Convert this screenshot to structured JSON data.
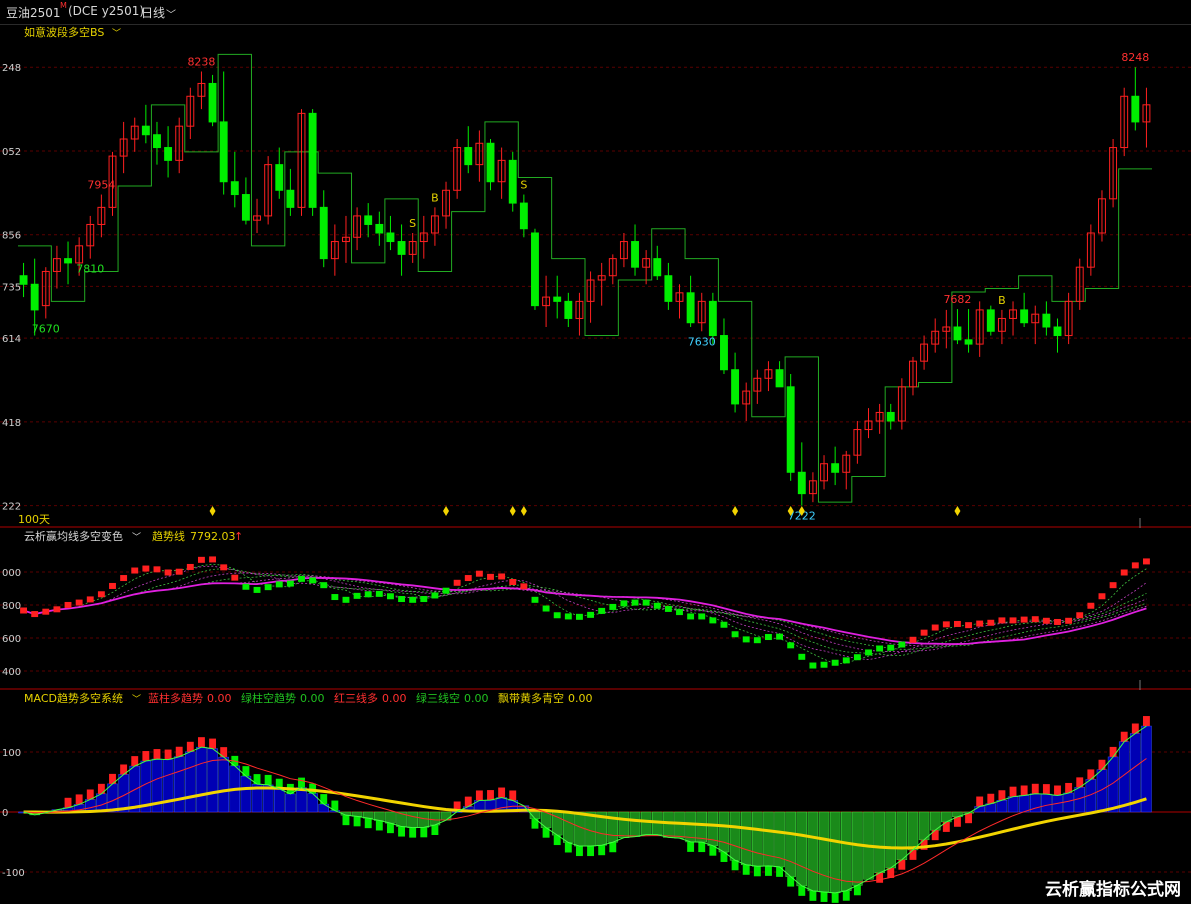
{
  "topbar": {
    "symbol": "豆油2501",
    "symbol_sup": "M",
    "exchange": "(DCE  y2501)",
    "period": "日线"
  },
  "colors": {
    "up": "#ff2020",
    "down": "#00ee00",
    "grid": "#5a0000",
    "axis": "#a00000",
    "macd_blue": "#0000b4",
    "yellow": "#f2d400",
    "cyan": "#7fe6ff",
    "magenta": "#e020e0"
  },
  "chart_data": [
    {
      "type": "candlestick",
      "title": "如意波段多空BS",
      "y_ticks": [
        "248",
        "052",
        "856",
        "735",
        "614",
        "418",
        "222"
      ],
      "y_tick_values": [
        8248,
        8052,
        7856,
        7735,
        7614,
        7418,
        7222
      ],
      "ylim": [
        7200,
        8300
      ],
      "range_label": "100天",
      "annotations": [
        {
          "text": "8238",
          "kind": "high"
        },
        {
          "text": "7630",
          "kind": "low"
        },
        {
          "text": "7954",
          "kind": "high"
        },
        {
          "text": "7810",
          "kind": "low"
        },
        {
          "text": "7670",
          "kind": "low"
        },
        {
          "text": "7222",
          "kind": "low"
        },
        {
          "text": "7682",
          "kind": "high"
        },
        {
          "text": "8248",
          "kind": "high"
        }
      ],
      "signals": [
        {
          "text": "S",
          "bar": 35
        },
        {
          "text": "B",
          "bar": 37
        },
        {
          "text": "S",
          "bar": 45
        },
        {
          "text": "B",
          "bar": 88
        }
      ],
      "diamond_bars": [
        17,
        38,
        44,
        45,
        64,
        69,
        70,
        84
      ],
      "ohlc": [
        [
          7760,
          7790,
          7710,
          7740
        ],
        [
          7740,
          7800,
          7620,
          7680
        ],
        [
          7690,
          7780,
          7660,
          7770
        ],
        [
          7770,
          7830,
          7730,
          7800
        ],
        [
          7800,
          7840,
          7740,
          7790
        ],
        [
          7790,
          7850,
          7760,
          7830
        ],
        [
          7830,
          7900,
          7800,
          7880
        ],
        [
          7880,
          7950,
          7850,
          7920
        ],
        [
          7920,
          8050,
          7900,
          8040
        ],
        [
          8040,
          8120,
          8000,
          8080
        ],
        [
          8080,
          8130,
          8050,
          8110
        ],
        [
          8110,
          8160,
          8070,
          8090
        ],
        [
          8090,
          8120,
          8020,
          8060
        ],
        [
          8060,
          8110,
          7990,
          8030
        ],
        [
          8030,
          8130,
          8000,
          8110
        ],
        [
          8110,
          8200,
          8080,
          8180
        ],
        [
          8180,
          8238,
          8150,
          8210
        ],
        [
          8210,
          8230,
          8110,
          8120
        ],
        [
          8120,
          8238,
          7950,
          7980
        ],
        [
          7980,
          8050,
          7920,
          7950
        ],
        [
          7950,
          7990,
          7880,
          7890
        ],
        [
          7890,
          7940,
          7860,
          7900
        ],
        [
          7900,
          8040,
          7880,
          8020
        ],
        [
          8020,
          8060,
          7940,
          7960
        ],
        [
          7960,
          8010,
          7900,
          7920
        ],
        [
          7920,
          8150,
          7900,
          8140
        ],
        [
          8140,
          8150,
          7900,
          7920
        ],
        [
          7920,
          7960,
          7780,
          7800
        ],
        [
          7800,
          7880,
          7760,
          7840
        ],
        [
          7840,
          7900,
          7790,
          7850
        ],
        [
          7850,
          7920,
          7820,
          7900
        ],
        [
          7900,
          7930,
          7850,
          7880
        ],
        [
          7880,
          7910,
          7830,
          7860
        ],
        [
          7860,
          7900,
          7820,
          7840
        ],
        [
          7840,
          7880,
          7760,
          7810
        ],
        [
          7810,
          7860,
          7790,
          7840
        ],
        [
          7840,
          7900,
          7800,
          7860
        ],
        [
          7860,
          7920,
          7830,
          7900
        ],
        [
          7900,
          7980,
          7870,
          7960
        ],
        [
          7960,
          8080,
          7940,
          8060
        ],
        [
          8060,
          8110,
          8000,
          8020
        ],
        [
          8020,
          8100,
          7980,
          8070
        ],
        [
          8070,
          8080,
          7960,
          7980
        ],
        [
          7980,
          8060,
          7940,
          8030
        ],
        [
          8030,
          8050,
          7910,
          7930
        ],
        [
          7930,
          7950,
          7850,
          7870
        ],
        [
          7860,
          7870,
          7680,
          7690
        ],
        [
          7690,
          7760,
          7640,
          7710
        ],
        [
          7710,
          7760,
          7660,
          7700
        ],
        [
          7700,
          7720,
          7640,
          7660
        ],
        [
          7660,
          7720,
          7620,
          7700
        ],
        [
          7700,
          7770,
          7650,
          7750
        ],
        [
          7750,
          7790,
          7690,
          7760
        ],
        [
          7760,
          7810,
          7740,
          7800
        ],
        [
          7800,
          7860,
          7780,
          7840
        ],
        [
          7840,
          7880,
          7760,
          7780
        ],
        [
          7780,
          7820,
          7740,
          7800
        ],
        [
          7800,
          7830,
          7750,
          7760
        ],
        [
          7760,
          7790,
          7680,
          7700
        ],
        [
          7700,
          7740,
          7660,
          7720
        ],
        [
          7720,
          7760,
          7640,
          7650
        ],
        [
          7650,
          7720,
          7630,
          7700
        ],
        [
          7700,
          7720,
          7600,
          7620
        ],
        [
          7620,
          7660,
          7530,
          7540
        ],
        [
          7540,
          7580,
          7440,
          7460
        ],
        [
          7460,
          7510,
          7420,
          7490
        ],
        [
          7490,
          7540,
          7460,
          7520
        ],
        [
          7520,
          7560,
          7490,
          7540
        ],
        [
          7540,
          7560,
          7500,
          7500
        ],
        [
          7500,
          7530,
          7280,
          7300
        ],
        [
          7300,
          7370,
          7222,
          7250
        ],
        [
          7250,
          7300,
          7230,
          7280
        ],
        [
          7280,
          7340,
          7260,
          7320
        ],
        [
          7320,
          7360,
          7270,
          7300
        ],
        [
          7300,
          7350,
          7260,
          7340
        ],
        [
          7340,
          7420,
          7320,
          7400
        ],
        [
          7400,
          7450,
          7380,
          7420
        ],
        [
          7420,
          7460,
          7390,
          7440
        ],
        [
          7440,
          7460,
          7400,
          7420
        ],
        [
          7420,
          7520,
          7400,
          7500
        ],
        [
          7500,
          7570,
          7480,
          7560
        ],
        [
          7560,
          7620,
          7540,
          7600
        ],
        [
          7600,
          7660,
          7580,
          7630
        ],
        [
          7630,
          7680,
          7590,
          7640
        ],
        [
          7640,
          7682,
          7600,
          7610
        ],
        [
          7610,
          7682,
          7580,
          7600
        ],
        [
          7600,
          7700,
          7570,
          7680
        ],
        [
          7680,
          7690,
          7620,
          7630
        ],
        [
          7630,
          7680,
          7600,
          7660
        ],
        [
          7660,
          7700,
          7620,
          7680
        ],
        [
          7680,
          7720,
          7640,
          7650
        ],
        [
          7650,
          7690,
          7600,
          7670
        ],
        [
          7670,
          7700,
          7620,
          7640
        ],
        [
          7640,
          7660,
          7580,
          7620
        ],
        [
          7620,
          7720,
          7600,
          7700
        ],
        [
          7700,
          7800,
          7680,
          7780
        ],
        [
          7780,
          7880,
          7760,
          7860
        ],
        [
          7860,
          7960,
          7840,
          7940
        ],
        [
          7940,
          8080,
          7920,
          8060
        ],
        [
          8060,
          8200,
          8040,
          8180
        ],
        [
          8180,
          8248,
          8100,
          8120
        ],
        [
          8120,
          8200,
          8060,
          8160
        ]
      ]
    },
    {
      "type": "line",
      "title": "云析赢均线多空变色",
      "label": "趋势线",
      "value": "7792.03",
      "arrow": "↑",
      "y_ticks": [
        "000",
        "800",
        "600",
        "400"
      ]
    },
    {
      "type": "bar",
      "title": "MACD趋势多空系统",
      "legend": [
        {
          "text": "蓝柱多趋势",
          "value": "0.00"
        },
        {
          "text": "绿柱空趋势",
          "value": "0.00"
        },
        {
          "text": "红三线多",
          "value": "0.00"
        },
        {
          "text": "绿三线空",
          "value": "0.00"
        },
        {
          "text": "飘带黄多青空",
          "value": "0.00"
        }
      ],
      "y_ticks": [
        "100",
        "0",
        "-100"
      ]
    }
  ],
  "watermark": "云析赢指标公式网"
}
